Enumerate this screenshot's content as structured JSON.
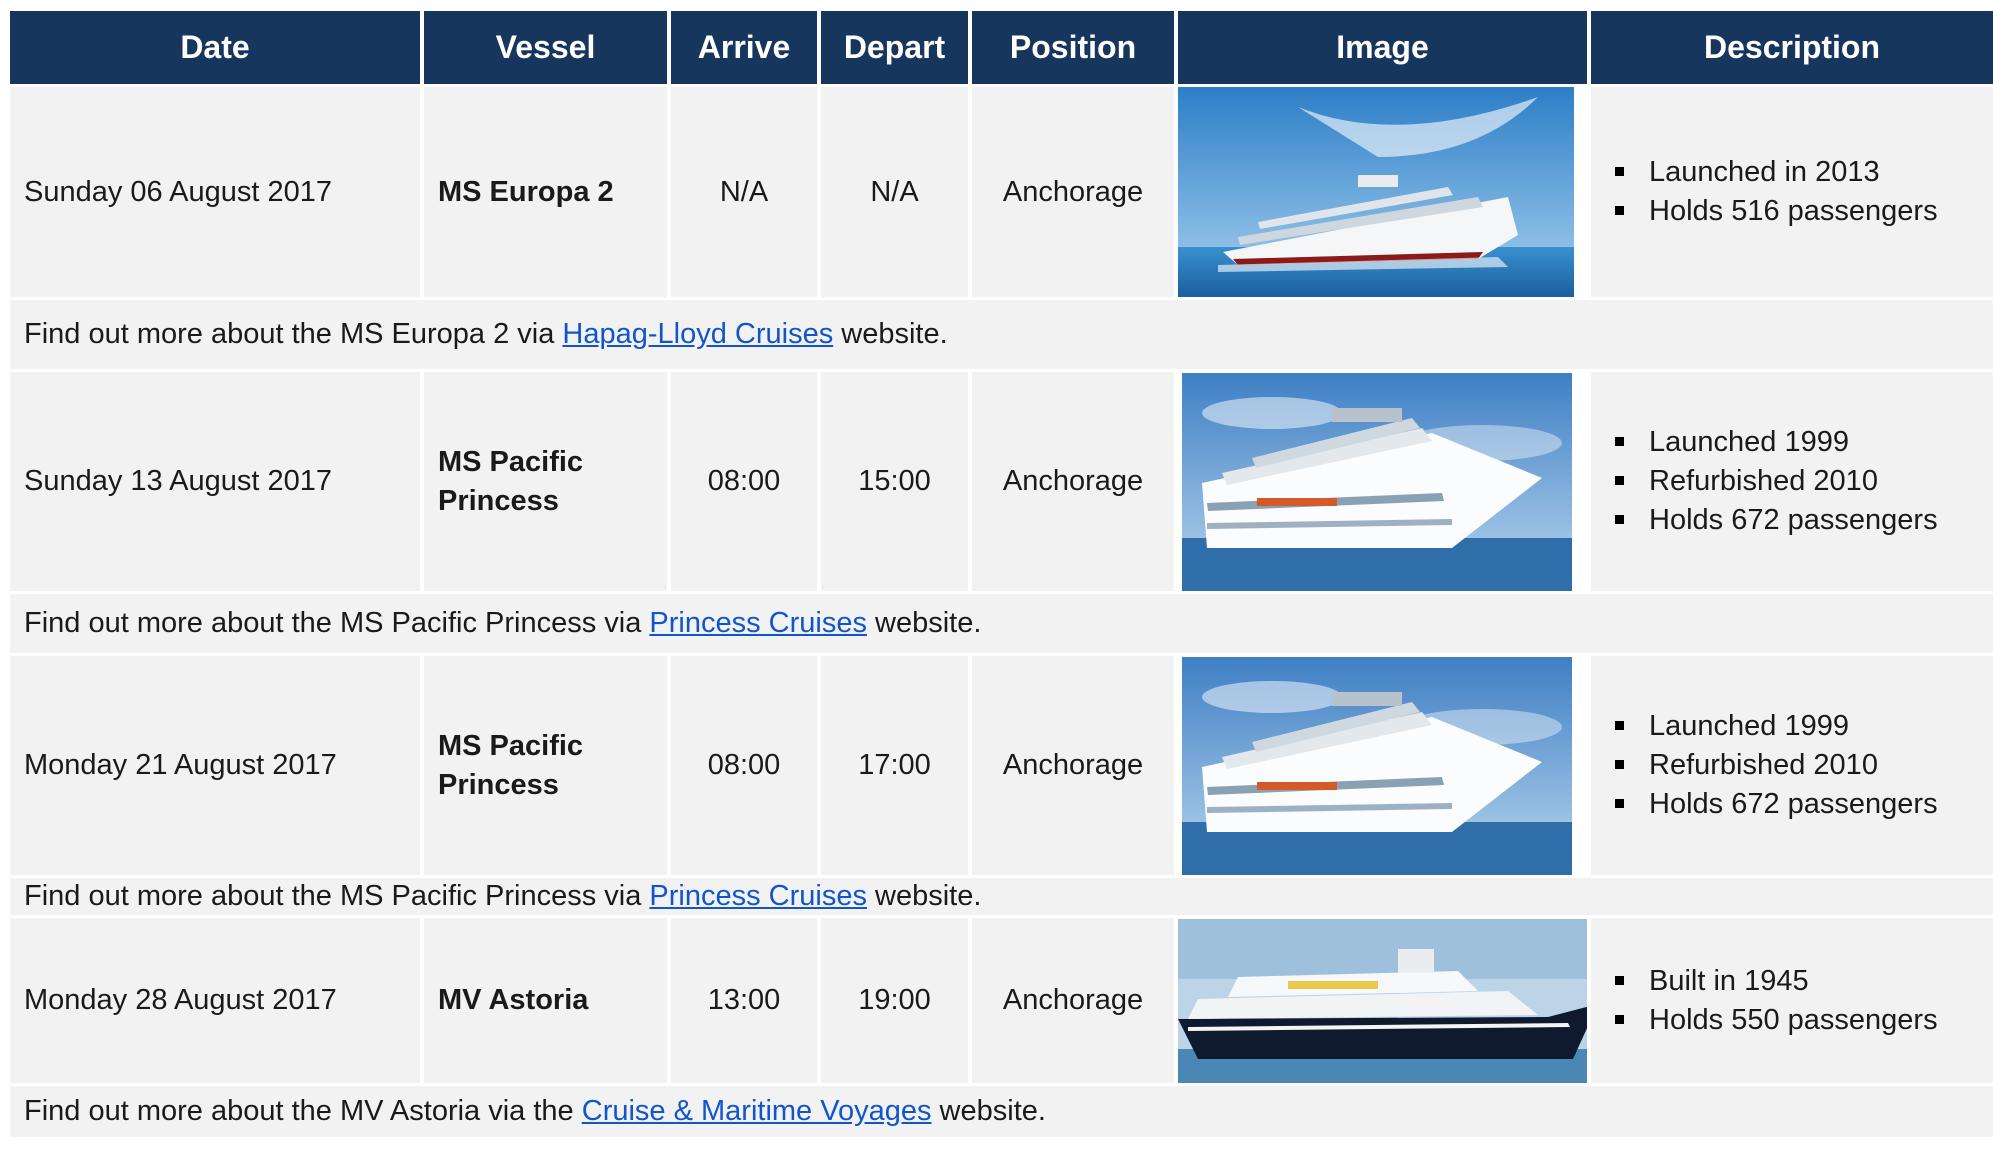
{
  "headers": {
    "date": "Date",
    "vessel": "Vessel",
    "arrive": "Arrive",
    "depart": "Depart",
    "position": "Position",
    "image": "Image",
    "description": "Description"
  },
  "rows": [
    {
      "date": "Sunday 06 August 2017",
      "vessel_line1": "MS Europa 2",
      "vessel_line2": "",
      "arrive": "N/A",
      "depart": "N/A",
      "position": "Anchorage",
      "description": [
        "Launched in 2013",
        "Holds 516 passengers"
      ],
      "note_before": "Find out more about the MS Europa 2 via ",
      "note_link": "Hapag-Lloyd Cruises",
      "note_after": " website."
    },
    {
      "date": "Sunday 13 August 2017",
      "vessel_line1": "MS Pacific",
      "vessel_line2": "Princess",
      "arrive": "08:00",
      "depart": "15:00",
      "position": "Anchorage",
      "description": [
        "Launched 1999",
        "Refurbished 2010",
        "Holds 672 passengers"
      ],
      "note_before": "Find out more about the MS Pacific Princess via ",
      "note_link": "Princess Cruises",
      "note_after": " website."
    },
    {
      "date": "Monday 21 August 2017",
      "vessel_line1": "MS Pacific",
      "vessel_line2": "Princess",
      "arrive": "08:00",
      "depart": "17:00",
      "position": "Anchorage",
      "description": [
        "Launched 1999",
        "Refurbished 2010",
        "Holds 672 passengers"
      ],
      "note_before": "Find out more about the MS Pacific Princess via ",
      "note_link": "Princess Cruises",
      "note_after": " website."
    },
    {
      "date": "Monday 28 August 2017",
      "vessel_line1": "MV Astoria",
      "vessel_line2": "",
      "arrive": "13:00",
      "depart": "19:00",
      "position": "Anchorage",
      "description": [
        "Built in 1945",
        "Holds 550 passengers"
      ],
      "note_before": "Find out more about the MV Astoria via the ",
      "note_link": "Cruise & Maritime Voyages",
      "note_after": " website."
    }
  ],
  "colors": {
    "header_bg": "#17365d",
    "cell_bg": "#f2f2f2",
    "link": "#1155cc"
  }
}
